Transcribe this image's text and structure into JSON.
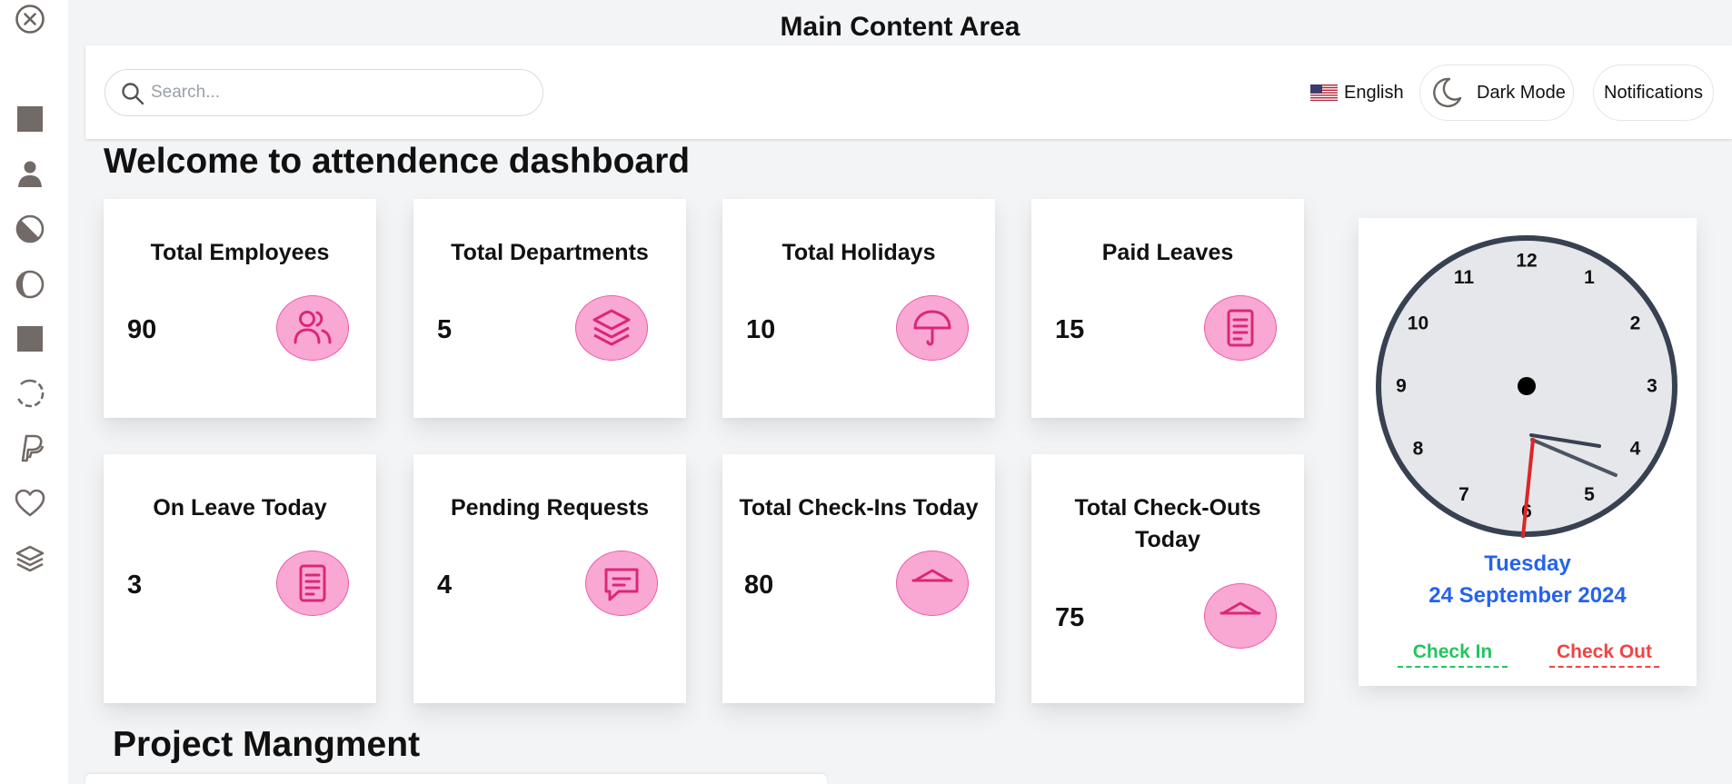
{
  "page": {
    "title": "Main Content Area"
  },
  "sidebar": {
    "items": [
      {
        "icon": "close-circle-icon"
      },
      {
        "icon": "square-icon"
      },
      {
        "icon": "user-icon"
      },
      {
        "icon": "half-circle-icon"
      },
      {
        "icon": "half-moon-icon"
      },
      {
        "icon": "square-icon"
      },
      {
        "icon": "loader-icon"
      },
      {
        "icon": "paypal-icon"
      },
      {
        "icon": "heart-icon"
      },
      {
        "icon": "layers-icon"
      }
    ]
  },
  "header": {
    "search": {
      "placeholder": "Search...",
      "value": ""
    },
    "language": {
      "flag": "us-flag-icon",
      "label": "English"
    },
    "dark_mode": {
      "label": "Dark Mode",
      "icon": "moon-icon"
    },
    "notifications": {
      "label": "Notifications"
    }
  },
  "main": {
    "welcome": "Welcome to attendence dashboard",
    "cards": [
      {
        "title": "Total Employees",
        "value": "90",
        "icon": "users-icon"
      },
      {
        "title": "Total Departments",
        "value": "5",
        "icon": "layers-icon"
      },
      {
        "title": "Total Holidays",
        "value": "10",
        "icon": "umbrella-icon"
      },
      {
        "title": "Paid Leaves",
        "value": "15",
        "icon": "document-icon"
      },
      {
        "title": "On Leave Today",
        "value": "3",
        "icon": "document-icon"
      },
      {
        "title": "Pending Requests",
        "value": "4",
        "icon": "message-icon"
      },
      {
        "title": "Total Check-Ins Today",
        "value": "80",
        "icon": "tent-icon"
      },
      {
        "title": "Total Check-Outs Today",
        "value": "75",
        "icon": "tent-icon"
      }
    ],
    "project_title": "Project Mangment"
  },
  "clock": {
    "numbers": [
      "12",
      "1",
      "2",
      "3",
      "4",
      "5",
      "6",
      "7",
      "8",
      "9",
      "10",
      "11"
    ],
    "day": "Tuesday",
    "date": "24 September 2024",
    "check_in_label": "Check In",
    "check_out_label": "Check Out"
  },
  "colors": {
    "accent_pink": "#f9a8d4",
    "icon_pink": "#db2777",
    "date_blue": "#2563eb",
    "check_in_green": "#22c55e",
    "check_out_red": "#ef4444",
    "clock_face": "#e5e7eb",
    "clock_rim": "#374151",
    "second_hand": "#dc2626"
  }
}
